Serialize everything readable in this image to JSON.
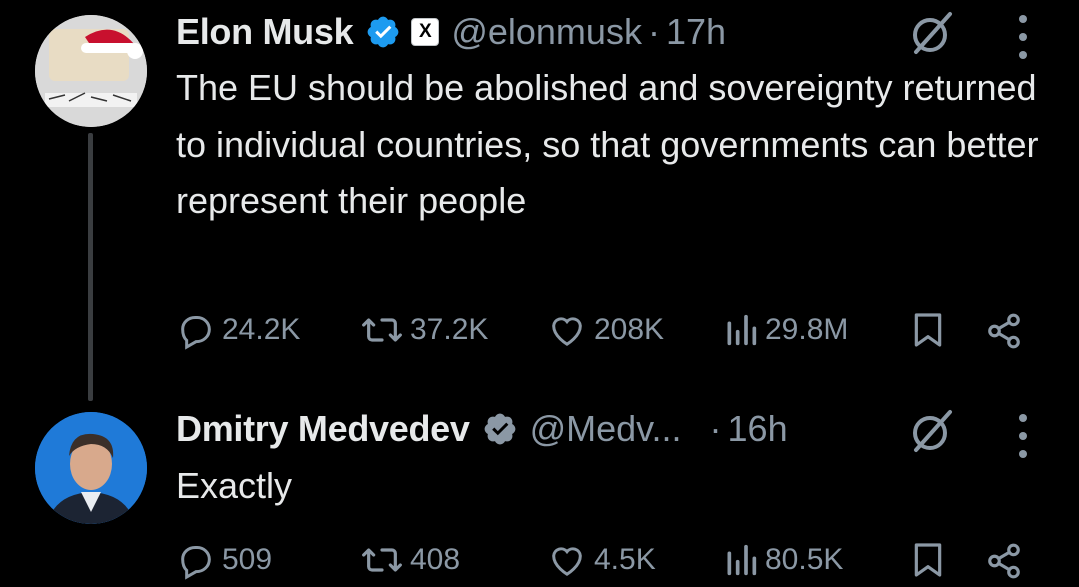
{
  "tweets": [
    {
      "name": "Elon Musk",
      "handle": "@elonmusk",
      "dot": "·",
      "time": "17h",
      "x_badge": "X",
      "avatar_icon": "santa-hat-avatar",
      "text": "The EU should be abolished and sovereignty returned to individual countries, so that governments can better represent their people",
      "replies": "24.2K",
      "reposts": "37.2K",
      "likes": "208K",
      "views": "29.8M"
    },
    {
      "name": "Dmitry Medvedev",
      "handle": "@Medv...",
      "dot": "·",
      "time": "16h",
      "avatar_icon": "portrait-avatar",
      "text": "Exactly",
      "replies": "509",
      "reposts": "408",
      "likes": "4.5K",
      "views": "80.5K"
    }
  ],
  "colors": {
    "background": "#000000",
    "text": "#e7e9ea",
    "muted": "#8b98a5",
    "verified": "#1d9bf0"
  }
}
